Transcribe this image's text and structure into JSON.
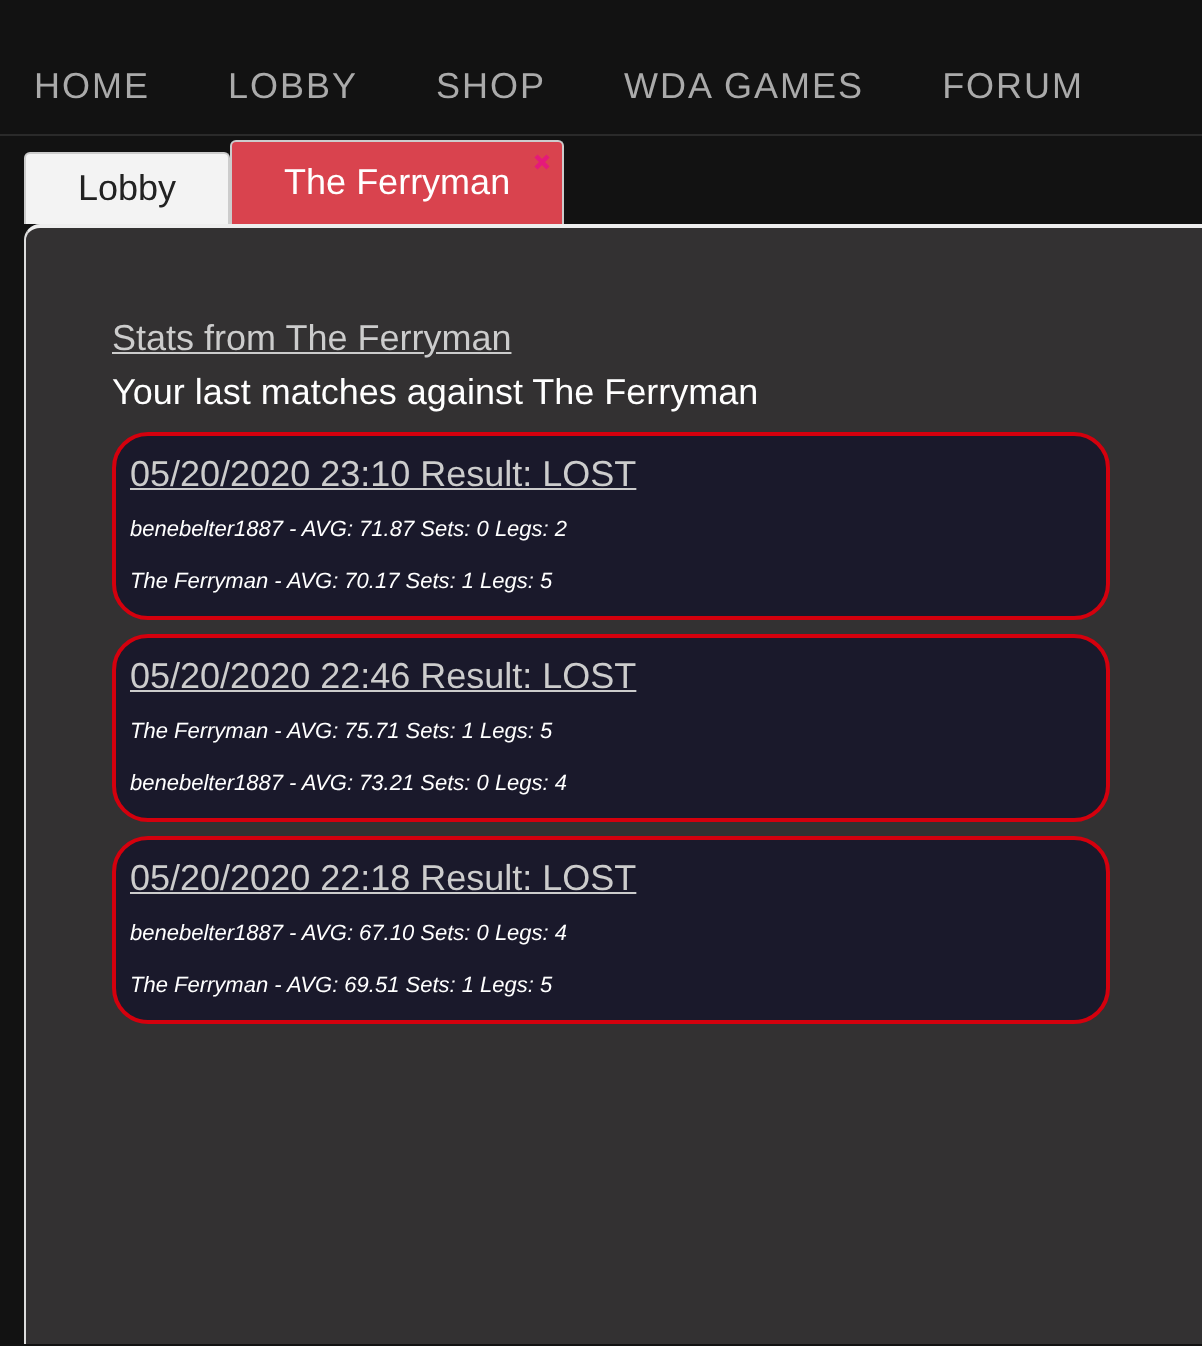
{
  "nav": [
    "HOME",
    "LOBBY",
    "SHOP",
    "WDA GAMES",
    "FORUM"
  ],
  "tabs": [
    {
      "label": "Lobby",
      "selected": false,
      "closable": false
    },
    {
      "label": "The Ferryman",
      "selected": true,
      "closable": true
    }
  ],
  "stats_link": "Stats from The Ferryman",
  "heading": "Your last matches against The Ferryman",
  "matches": [
    {
      "title": "05/20/2020 23:10 Result: LOST",
      "lines": [
        "benebelter1887 - AVG: 71.87 Sets: 0 Legs: 2",
        "The Ferryman - AVG: 70.17 Sets: 1 Legs: 5"
      ]
    },
    {
      "title": "05/20/2020 22:46 Result: LOST",
      "lines": [
        "The Ferryman - AVG: 75.71 Sets: 1 Legs: 5",
        "benebelter1887 - AVG: 73.21 Sets: 0 Legs: 4"
      ]
    },
    {
      "title": "05/20/2020 22:18 Result: LOST",
      "lines": [
        "benebelter1887 - AVG: 67.10 Sets: 0 Legs: 4",
        "The Ferryman - AVG: 69.51 Sets: 1 Legs: 5"
      ]
    }
  ]
}
